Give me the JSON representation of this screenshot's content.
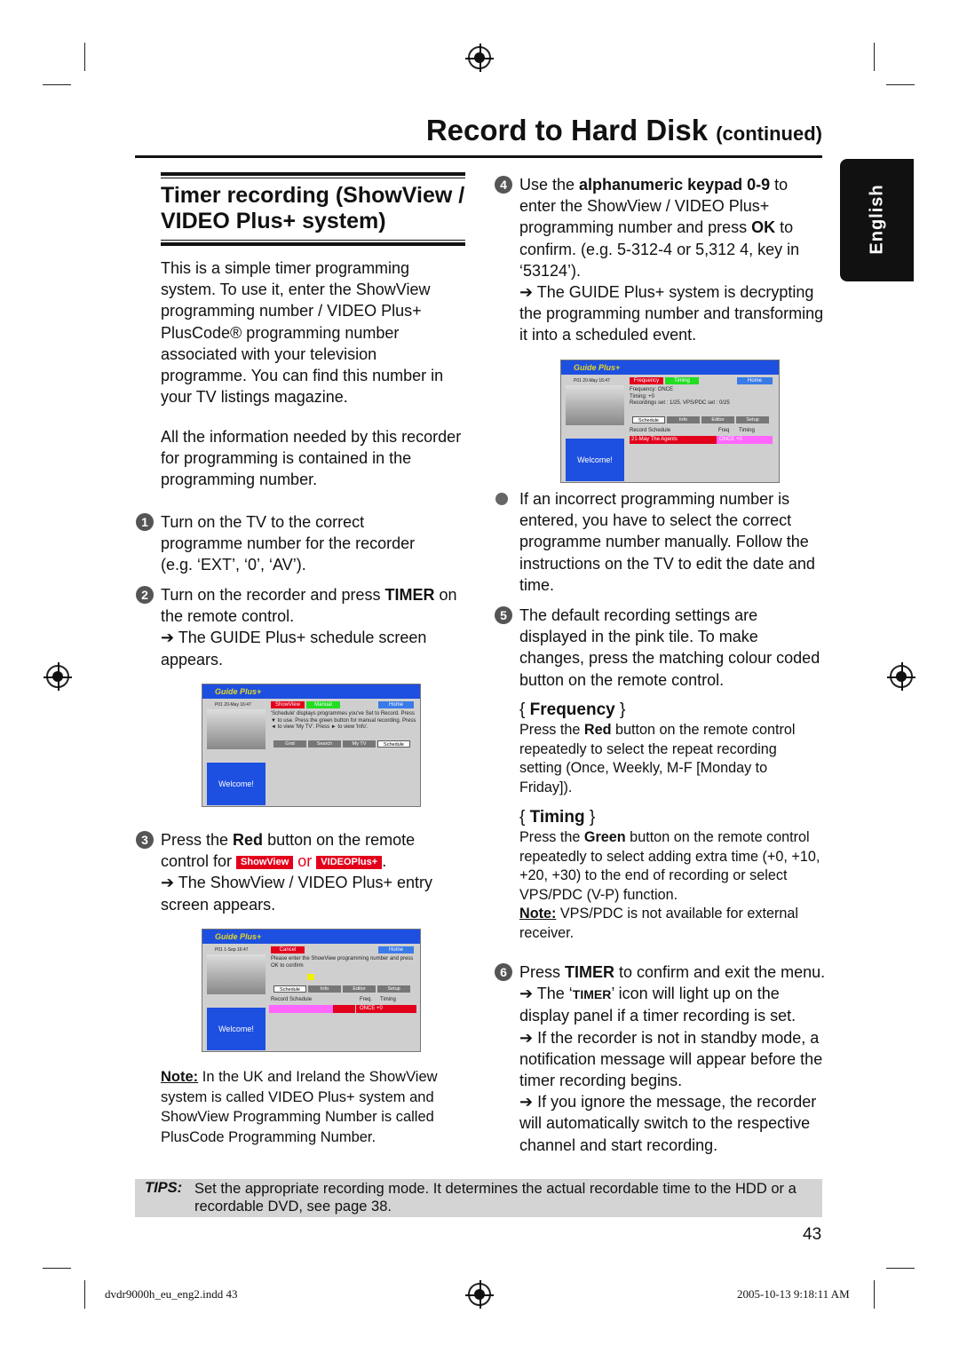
{
  "header": {
    "title": "Record to Hard Disk",
    "title_suffix": "(continued)"
  },
  "language_tab": "English",
  "section": {
    "title_line1": "Timer recording (ShowView /",
    "title_line2": "VIDEO Plus+ system)"
  },
  "intro": {
    "p1": "This is a simple timer programming system. To use it, enter the ShowView programming number / VIDEO Plus+ PlusCode® programming number associated with your television programme. You can find this number in your TV listings magazine.",
    "p2": "All the information needed by this recorder for programming is contained in the programming number."
  },
  "steps": [
    {
      "num": "1",
      "text": "Turn on the TV to the correct programme number for the recorder (e.g. ‘EXT’, ‘0’, ‘AV’)."
    },
    {
      "num": "2",
      "pre": "Turn on the recorder and press ",
      "bold": "TIMER",
      "post": " on the remote control.",
      "result": "➔ The GUIDE Plus+ schedule screen appears."
    },
    {
      "num": "3",
      "pre": "Press the ",
      "bold": "Red",
      "post": " button on the remote control for ",
      "tag1": "ShowView",
      "or": "or",
      "tag2": "VIDEOPlus+",
      "end": ".",
      "result": "➔ The ShowView / VIDEO Plus+ entry screen appears."
    },
    {
      "num": "4",
      "pre": "Use the ",
      "bold": "alphanumeric keypad 0-9",
      "mid": " to enter the ShowView / VIDEO Plus+ programming number and press ",
      "bold2": "OK",
      "post": " to confirm. (e.g. 5-312-4 or 5,312 4, key in ‘53124’).",
      "result": "➔ The GUIDE Plus+ system is decrypting the programming number and transforming it into a scheduled event."
    },
    {
      "num": "5",
      "text": "The default recording settings are displayed in the pink tile. To make changes, press the matching colour coded button on the remote control."
    },
    {
      "num": "6",
      "pre": "Press ",
      "bold": "TIMER",
      "post": " to confirm and exit the menu.",
      "r1_pre": "➔ The ‘",
      "r1_caps": "TIMER",
      "r1_post": "’ icon will light up on the display panel if a timer recording is set.",
      "r2": "➔ If the recorder is not in standby mode, a notification message will appear before the timer recording begins.",
      "r3": "➔ If you ignore the message, the recorder will automatically switch to the respective channel and start recording."
    }
  ],
  "bullet_note": "If an incorrect programming number is entered, you have to select the correct programme number manually. Follow the instructions on the TV to edit the date and time.",
  "frequency": {
    "heading_open": "{ ",
    "heading": "Frequency",
    "heading_close": " }",
    "pre": "Press the ",
    "bold": "Red",
    "post": " button on the remote control repeatedly to select the repeat recording setting (Once, Weekly, M-F [Monday to Friday])."
  },
  "timing": {
    "heading_open": "{ ",
    "heading": "Timing",
    "heading_close": " }",
    "pre": "Press the ",
    "bold": "Green",
    "post": " button on the remote control repeatedly to select adding extra time (+0, +10, +20, +30) to the end of recording or select VPS/PDC (V-P) function.",
    "note_label": "Note:",
    "note": " VPS/PDC is not available for external receiver."
  },
  "uk_note": {
    "label": "Note:",
    "text": "  In the UK and Ireland the ShowView system is called VIDEO Plus+ system and ShowView Programming Number is called PlusCode Programming Number."
  },
  "tips": {
    "label": "TIPS:",
    "text": "Set the appropriate recording mode. It determines the actual recordable time to the HDD or a recordable DVD, see page 38."
  },
  "page_number": "43",
  "footer": {
    "left": "dvdr9000h_eu_eng2.indd   43",
    "right": "2005-10-13   9:18:11 AM"
  },
  "screens": {
    "common": {
      "logo": "Guide Plus+",
      "welcome": "Welcome!",
      "home": "Home"
    },
    "schedule": {
      "info": "P01   20-May   16:47",
      "btn1": "ShowView",
      "btn2": "Manual",
      "text": "'Schedule' displays programmes you've Set to Record. Press ▼ to use.  Press the green button for manual recording. Press ◄ to view 'My TV'.  Press ► to view 'Info'.",
      "tabs": [
        "Grid",
        "Search",
        "My TV",
        "Schedule"
      ]
    },
    "entry": {
      "info": "P01   1-Sep   16:47",
      "btn1": "Cancel",
      "text": "Please enter the ShowView programming number and press OK to confirm",
      "tabs": [
        "Schedule",
        "Info",
        "Editor",
        "Setup"
      ],
      "rec_label": "Record Schedule",
      "freq_label": "Freq.",
      "timing_label": "Timing",
      "freq": "ONCE",
      "timing": "+0"
    },
    "decoded": {
      "info": "P01   20-May   16:47",
      "btn1": "Frequency",
      "btn2": "Timing",
      "line1": "Frequency:  ONCE",
      "line2": "Timing:  +0",
      "line3": "Recordings set :  1/25.  VPS/PDC set : 0/25",
      "tabs": [
        "Schedule",
        "Info",
        "Editor",
        "Setup"
      ],
      "rec_label": "Record Schedule",
      "freq_label": "Freq",
      "timing_label": "Timing",
      "event": "21-May   The Agents",
      "freq": "ONCE",
      "timing": "+0"
    }
  },
  "colors": {
    "red": "#e3001b",
    "blue": "#1d4fe0",
    "green": "#22dd22",
    "pink": "#ff66ff"
  }
}
